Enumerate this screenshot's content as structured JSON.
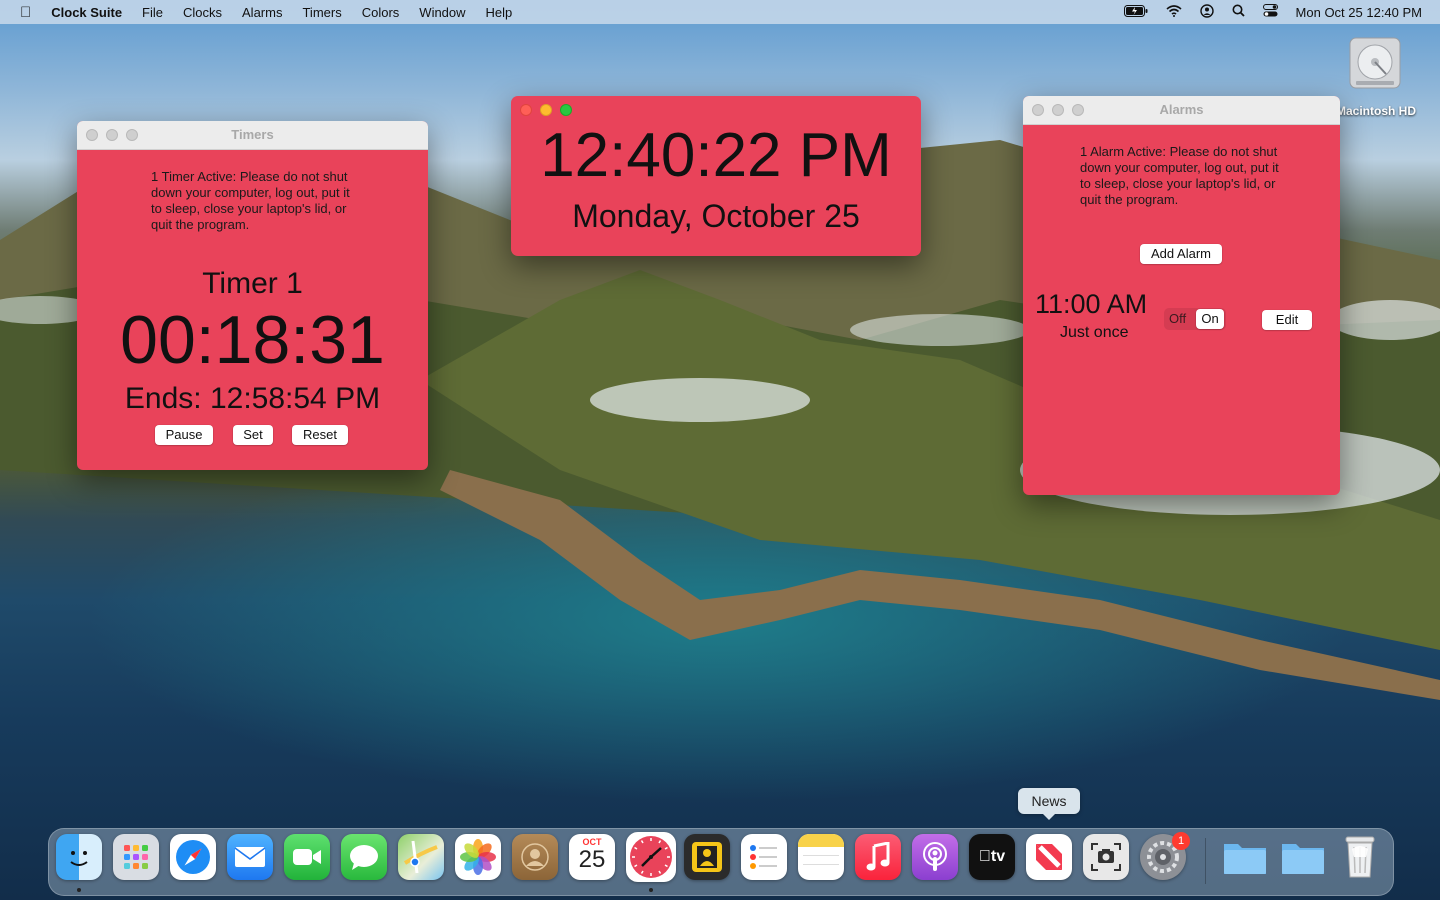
{
  "menubar": {
    "app_name": "Clock Suite",
    "menus": [
      "File",
      "Clocks",
      "Alarms",
      "Timers",
      "Colors",
      "Window",
      "Help"
    ],
    "clock": "Mon Oct 25  12:40 PM"
  },
  "desktop": {
    "disk_label": "Macintosh HD"
  },
  "timers_window": {
    "title": "Timers",
    "warning": "1 Timer Active: Please do not shut down your computer, log out, put it to sleep, close your laptop's lid, or quit the program.",
    "timer_name": "Timer 1",
    "time_remaining": "00:18:31",
    "ends": "Ends: 12:58:54 PM",
    "pause_label": "Pause",
    "set_label": "Set",
    "reset_label": "Reset"
  },
  "clock_window": {
    "time": "12:40:22 PM",
    "date": "Monday, October 25"
  },
  "alarms_window": {
    "title": "Alarms",
    "warning": "1 Alarm Active: Please do not shut down your computer, log out, put it to sleep, close your laptop's lid, or quit the program.",
    "add_label": "Add Alarm",
    "alarm_time": "11:00 AM",
    "alarm_repeat": "Just once",
    "off_label": "Off",
    "on_label": "On",
    "edit_label": "Edit"
  },
  "colors": {
    "window_bg": "#e9435a",
    "accent": "#e9435a"
  },
  "dock": {
    "tooltip": "News",
    "calendar_month": "OCT",
    "calendar_day": "25",
    "settings_badge": "1",
    "apps": [
      "finder-icon",
      "launchpad-icon",
      "safari-icon",
      "mail-icon",
      "facetime-icon",
      "messages-icon",
      "maps-icon",
      "photos-icon",
      "contacts-icon",
      "calendar-icon",
      "clock-suite-icon",
      "photo-booth-icon",
      "reminders-icon",
      "notes-icon",
      "music-icon",
      "podcasts-icon",
      "tv-icon",
      "news-icon",
      "screenshot-icon",
      "system-preferences-icon",
      "downloads-folder-icon",
      "documents-folder-icon",
      "trash-icon"
    ]
  }
}
